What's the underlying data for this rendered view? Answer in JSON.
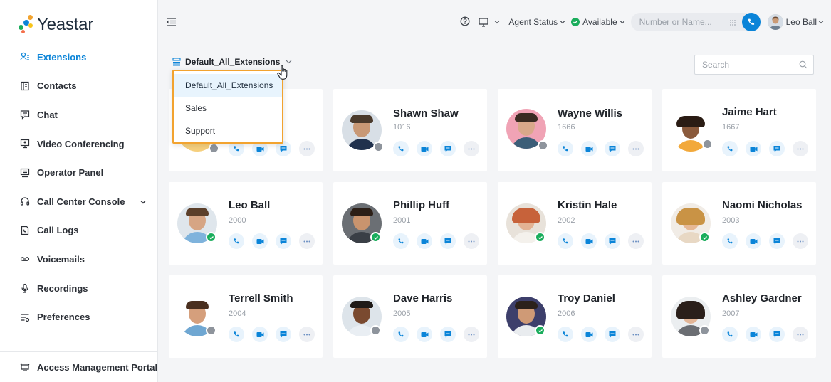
{
  "app": {
    "brand": "Yeastar"
  },
  "sidebar": {
    "items": [
      {
        "label": "Extensions",
        "icon": "extensions-icon",
        "active": true
      },
      {
        "label": "Contacts",
        "icon": "contacts-icon"
      },
      {
        "label": "Chat",
        "icon": "chat-icon"
      },
      {
        "label": "Video Conferencing",
        "icon": "video-conferencing-icon"
      },
      {
        "label": "Operator Panel",
        "icon": "operator-panel-icon"
      },
      {
        "label": "Call Center Console",
        "icon": "headset-icon",
        "expandable": true
      },
      {
        "label": "Call Logs",
        "icon": "call-logs-icon"
      },
      {
        "label": "Voicemails",
        "icon": "voicemail-icon"
      },
      {
        "label": "Recordings",
        "icon": "microphone-icon"
      },
      {
        "label": "Preferences",
        "icon": "preferences-icon"
      }
    ],
    "bottom": {
      "label": "Access Management Portal",
      "icon": "portal-icon"
    }
  },
  "header": {
    "agent_status": "Agent Status",
    "availability": "Available",
    "dial_placeholder": "Number or Name...",
    "user_name": "Leo Ball"
  },
  "main": {
    "group_selected": "Default_All_Extensions",
    "search_placeholder": "Search",
    "dropdown_options": [
      "Default_All_Extensions",
      "Sales",
      "Support"
    ]
  },
  "colors": {
    "accent": "#0a84d8",
    "available": "#1aad5c",
    "offline": "#8e949c",
    "highlight_border": "#f2a32f"
  },
  "extensions": [
    {
      "name": "",
      "ext": "",
      "status": "offline"
    },
    {
      "name": "Shawn Shaw",
      "ext": "1016",
      "status": "offline"
    },
    {
      "name": "Wayne Willis",
      "ext": "1666",
      "status": "offline"
    },
    {
      "name": "Jaime Hart",
      "ext": "1667",
      "status": "offline"
    },
    {
      "name": "Leo Ball",
      "ext": "2000",
      "status": "available"
    },
    {
      "name": "Phillip Huff",
      "ext": "2001",
      "status": "available"
    },
    {
      "name": "Kristin Hale",
      "ext": "2002",
      "status": "available"
    },
    {
      "name": "Naomi Nicholas",
      "ext": "2003",
      "status": "available"
    },
    {
      "name": "Terrell Smith",
      "ext": "2004",
      "status": "offline"
    },
    {
      "name": "Dave Harris",
      "ext": "2005",
      "status": "offline"
    },
    {
      "name": "Troy Daniel",
      "ext": "2006",
      "status": "available"
    },
    {
      "name": "Ashley Gardner",
      "ext": "2007",
      "status": "offline"
    }
  ]
}
